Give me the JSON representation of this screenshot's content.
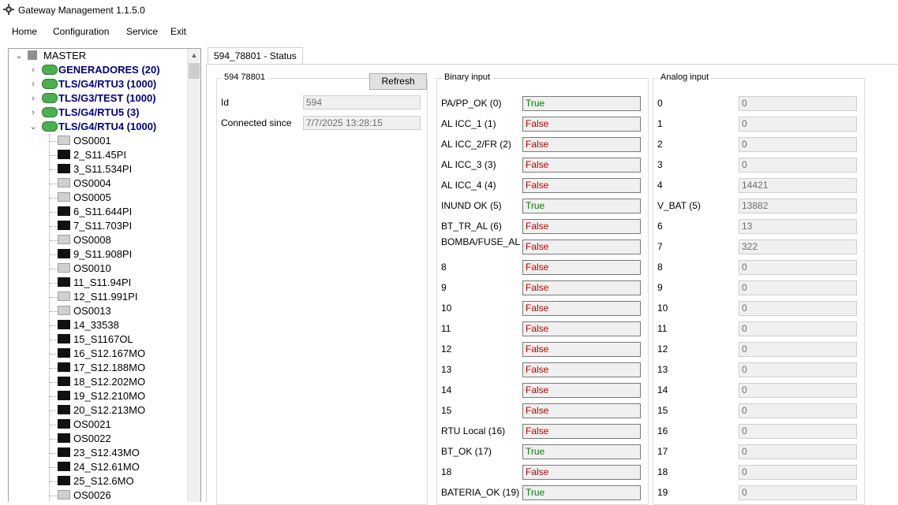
{
  "window": {
    "title": "Gateway Management 1.1.5.0"
  },
  "menu": [
    "Home",
    "Configuration",
    "Service",
    "Exit"
  ],
  "tree": {
    "root": "MASTER",
    "groups": [
      {
        "label": "GENERADORES (20)",
        "expanded": false
      },
      {
        "label": "TLS/G4/RTU3 (1000)",
        "expanded": false
      },
      {
        "label": "TLS/G3/TEST (1000)",
        "expanded": false
      },
      {
        "label": "TLS/G4/RTU5 (3)",
        "expanded": false
      },
      {
        "label": "TLS/G4/RTU4 (1000)",
        "expanded": true
      }
    ],
    "children": [
      {
        "label": "OS0001",
        "icon": "device-offline-icon"
      },
      {
        "label": "2_S11.45PI",
        "icon": "device-online-icon"
      },
      {
        "label": "3_S11.534PI",
        "icon": "device-online-icon"
      },
      {
        "label": "OS0004",
        "icon": "device-offline-icon"
      },
      {
        "label": "OS0005",
        "icon": "device-offline-icon"
      },
      {
        "label": "6_S11.644PI",
        "icon": "device-online-icon"
      },
      {
        "label": "7_S11.703PI",
        "icon": "device-online-icon"
      },
      {
        "label": "OS0008",
        "icon": "device-offline-icon"
      },
      {
        "label": "9_S11.908PI",
        "icon": "device-online-icon"
      },
      {
        "label": "OS0010",
        "icon": "device-offline-icon"
      },
      {
        "label": "11_S11.94PI",
        "icon": "device-online-icon"
      },
      {
        "label": "12_S11.991PI",
        "icon": "device-offline-icon"
      },
      {
        "label": "OS0013",
        "icon": "device-offline-icon"
      },
      {
        "label": "14_33538",
        "icon": "device-online-icon"
      },
      {
        "label": "15_S1167OL",
        "icon": "device-online-icon"
      },
      {
        "label": "16_S12.167MO",
        "icon": "device-online-icon"
      },
      {
        "label": "17_S12.188MO",
        "icon": "device-online-icon"
      },
      {
        "label": "18_S12.202MO",
        "icon": "device-online-icon"
      },
      {
        "label": "19_S12.210MO",
        "icon": "device-online-icon"
      },
      {
        "label": "20_S12.213MO",
        "icon": "device-online-icon"
      },
      {
        "label": "OS0021",
        "icon": "device-online-icon"
      },
      {
        "label": "OS0022",
        "icon": "device-online-icon"
      },
      {
        "label": "23_S12.43MO",
        "icon": "device-online-icon"
      },
      {
        "label": "24_S12.61MO",
        "icon": "device-online-icon"
      },
      {
        "label": "25_S12.6MO",
        "icon": "device-online-icon"
      },
      {
        "label": "OS0026",
        "icon": "device-offline-icon"
      }
    ]
  },
  "tab": {
    "label": "594_78801 - Status"
  },
  "device": {
    "group_title": "594 78801",
    "refresh_label": "Refresh",
    "id_label": "Id",
    "id_value": "594",
    "connected_label": "Connected since",
    "connected_value": "7/7/2025 13:28:15"
  },
  "binary": {
    "title": "Binary input",
    "items": [
      {
        "label": "PA/PP_OK (0)",
        "value": "True"
      },
      {
        "label": "AL ICC_1 (1)",
        "value": "False"
      },
      {
        "label": "AL ICC_2/FR (2)",
        "value": "False"
      },
      {
        "label": "AL ICC_3 (3)",
        "value": "False"
      },
      {
        "label": "AL ICC_4 (4)",
        "value": "False"
      },
      {
        "label": "INUND OK (5)",
        "value": "True"
      },
      {
        "label": "BT_TR_AL (6)",
        "value": "False"
      },
      {
        "label": "BOMBA/FUSE_AL",
        "value": "False"
      },
      {
        "label": "8",
        "value": "False"
      },
      {
        "label": "9",
        "value": "False"
      },
      {
        "label": "10",
        "value": "False"
      },
      {
        "label": "11",
        "value": "False"
      },
      {
        "label": "12",
        "value": "False"
      },
      {
        "label": "13",
        "value": "False"
      },
      {
        "label": "14",
        "value": "False"
      },
      {
        "label": "15",
        "value": "False"
      },
      {
        "label": "RTU Local (16)",
        "value": "False"
      },
      {
        "label": "BT_OK (17)",
        "value": "True"
      },
      {
        "label": "18",
        "value": "False"
      },
      {
        "label": "BATERIA_OK (19)",
        "value": "True"
      }
    ]
  },
  "analog": {
    "title": "Analog input",
    "items": [
      {
        "label": "0",
        "value": "0"
      },
      {
        "label": "1",
        "value": "0"
      },
      {
        "label": "2",
        "value": "0"
      },
      {
        "label": "3",
        "value": "0"
      },
      {
        "label": "4",
        "value": "14421"
      },
      {
        "label": "V_BAT (5)",
        "value": "13882"
      },
      {
        "label": "6",
        "value": "13"
      },
      {
        "label": "7",
        "value": "322"
      },
      {
        "label": "8",
        "value": "0"
      },
      {
        "label": "9",
        "value": "0"
      },
      {
        "label": "10",
        "value": "0"
      },
      {
        "label": "11",
        "value": "0"
      },
      {
        "label": "12",
        "value": "0"
      },
      {
        "label": "13",
        "value": "0"
      },
      {
        "label": "14",
        "value": "0"
      },
      {
        "label": "15",
        "value": "0"
      },
      {
        "label": "16",
        "value": "0"
      },
      {
        "label": "17",
        "value": "0"
      },
      {
        "label": "18",
        "value": "0"
      },
      {
        "label": "19",
        "value": "0"
      }
    ]
  },
  "colors": {
    "true": "#008000",
    "false": "#c00000",
    "group_label": "#000080"
  }
}
